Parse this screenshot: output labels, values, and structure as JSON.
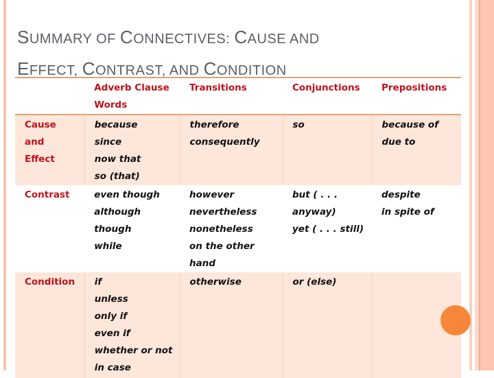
{
  "slide": {
    "title_line1": [
      {
        "text": "S",
        "big": true
      },
      {
        "text": "ummary of ",
        "big": false
      },
      {
        "text": "C",
        "big": true
      },
      {
        "text": "onnectives: ",
        "big": false
      },
      {
        "text": "C",
        "big": true
      },
      {
        "text": "ause and",
        "big": false
      }
    ],
    "title_line2": [
      {
        "text": "E",
        "big": true
      },
      {
        "text": "ffect, ",
        "big": false
      },
      {
        "text": "C",
        "big": true
      },
      {
        "text": "ontrast, and ",
        "big": false
      },
      {
        "text": "C",
        "big": true
      },
      {
        "text": "ondition",
        "big": false
      }
    ],
    "title_text": "Summary of Connectives: Cause and Effect, Contrast, and Condition",
    "colors": {
      "header_text": "#c0111b",
      "row_shade": "#fde6da",
      "title_text": "#5a5e66",
      "accent_rule": "#d9a47a",
      "decor_circle": "#f6873a"
    }
  },
  "table": {
    "headers": [
      "",
      "Adverb Clause Words",
      "Transitions",
      "Conjunctions",
      "Prepositions"
    ],
    "rows": [
      {
        "label": "Cause and Effect",
        "adverb_clause_words": [
          "because",
          "since",
          "now that",
          "so (that)"
        ],
        "transitions": [
          "therefore",
          "consequently"
        ],
        "conjunctions": [
          "so"
        ],
        "prepositions": [
          "because of",
          "due to"
        ]
      },
      {
        "label": "Contrast",
        "adverb_clause_words": [
          "even though",
          "although",
          "though",
          "while"
        ],
        "transitions": [
          "however",
          "nevertheless",
          "nonetheless",
          "on the other",
          "hand"
        ],
        "conjunctions": [
          "but ( . . .",
          "anyway)",
          "yet ( . . . still)"
        ],
        "prepositions": [
          "despite",
          "in spite of"
        ]
      },
      {
        "label": "Condition",
        "adverb_clause_words": [
          "if",
          "unless",
          "only if",
          "even if",
          "whether or not",
          "in case"
        ],
        "transitions": [
          "otherwise"
        ],
        "conjunctions": [
          "or (else)"
        ],
        "prepositions": []
      }
    ]
  }
}
